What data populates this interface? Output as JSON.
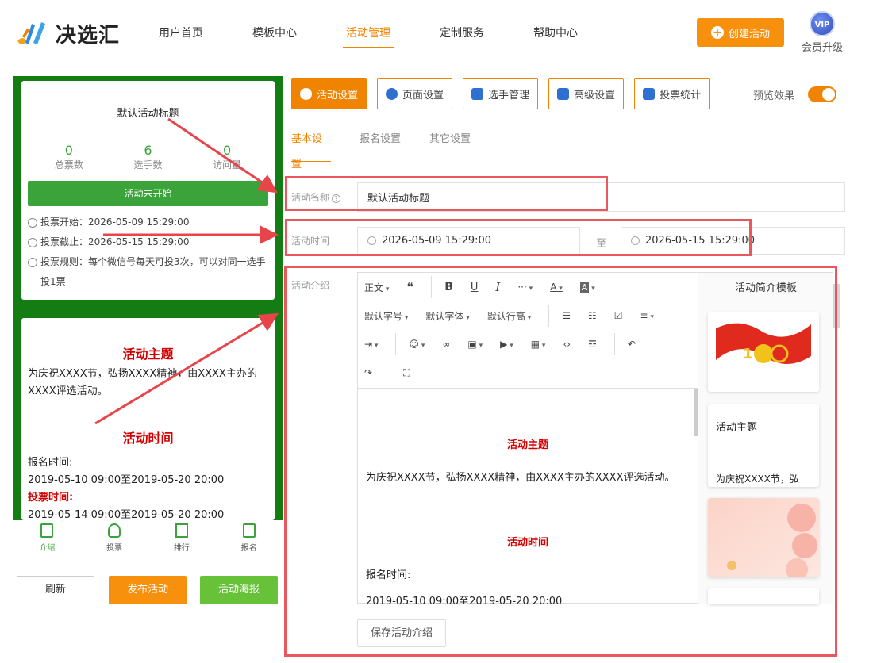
{
  "header": {
    "brand": "决选汇",
    "nav": [
      "用户首页",
      "模板中心",
      "活动管理",
      "定制服务",
      "帮助中心"
    ],
    "active_nav": "活动管理",
    "create_button": "创建活动",
    "vip_badge": "VIP",
    "vip_label": "会员升级",
    "accent_color": "#f08300"
  },
  "preview": {
    "title": "默认活动标题",
    "stats": [
      {
        "num": "0",
        "label": "总票数"
      },
      {
        "num": "6",
        "label": "选手数"
      },
      {
        "num": "0",
        "label": "访问量"
      }
    ],
    "status_label": "活动未开始",
    "vote_start": "投票开始：2026-05-09 15:29:00",
    "vote_end": "投票截止：2026-05-15 15:29:00",
    "vote_rule": "投票规则：每个微信号每天可投3次，可以对同一选手投1票",
    "theme_head": "活动主题",
    "theme_body": "为庆祝XXXX节，弘扬XXXX精神，由XXXX主办的XXXX评选活动。",
    "time_head": "活动时间",
    "signup_label": "报名时间:",
    "signup_range": "2019-05-10 09:00至2019-05-20 20:00",
    "vote_label": "投票时间:",
    "vote_range": "2019-05-14 09:00至2019-05-20 20:00",
    "tabs": [
      "介绍",
      "投票",
      "排行",
      "报名"
    ],
    "bg_color": "#137d13"
  },
  "actions": {
    "refresh": "刷新",
    "publish": "发布活动",
    "poster": "活动海报"
  },
  "settings": {
    "top_buttons": [
      "活动设置",
      "页面设置",
      "选手管理",
      "高级设置",
      "投票统计"
    ],
    "preview_label": "预览效果",
    "preview_toggle": true,
    "sub_tabs": [
      "基本设置",
      "报名设置",
      "其它设置"
    ],
    "name_label": "活动名称",
    "name_value": "默认活动标题",
    "time_label": "活动时间",
    "start_time": "2026-05-09 15:29:00",
    "to": "至",
    "end_time": "2026-05-15 15:29:00",
    "intro_label": "活动介绍"
  },
  "editor": {
    "row1": [
      "正文",
      "66",
      "B",
      "U",
      "I",
      "···",
      "A",
      "A"
    ],
    "row2": [
      "默认字号",
      "默认字体",
      "默认行高"
    ],
    "body": {
      "theme_head": "活动主题",
      "theme_body": "为庆祝XXXX节，弘扬XXXX精神，由XXXX主办的XXXX评选活动。",
      "time_head": "活动时间",
      "signup_label": "报名时间:",
      "signup_range": "2019-05-10 09:00至2019-05-20 20:00"
    },
    "save_button": "保存活动介绍"
  },
  "templates": {
    "title": "活动简介模板",
    "card2_title": "活动主题",
    "card2_text": "为庆祝XXXX节，弘"
  }
}
